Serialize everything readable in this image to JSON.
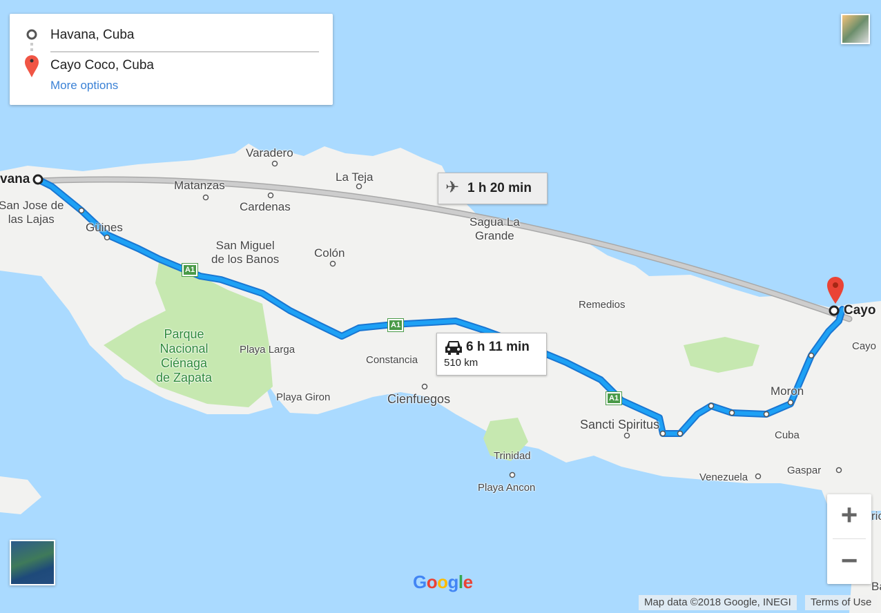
{
  "directions": {
    "origin": "Havana, Cuba",
    "destination": "Cayo Coco, Cuba",
    "more_options": "More options"
  },
  "routes": {
    "flight": {
      "icon": "airplane-icon",
      "duration": "1 h 20 min"
    },
    "driving": {
      "icon": "car-icon",
      "duration": "6 h 11 min",
      "distance": "510 km"
    }
  },
  "map": {
    "labels": [
      "vana",
      "San Jose de\nlas Lajas",
      "Güines",
      "Matanzas",
      "Varadero",
      "Cardenas",
      "La Teja",
      "San Miguel\nde los Banos",
      "Colón",
      "Sagua La\nGrande",
      "Remedios",
      "Cayo",
      "Cayo",
      "Parque\nNacional\nCiénaga\nde Zapata",
      "Playa Larga",
      "Constancia",
      "Playa Giron",
      "Cienfuegos",
      "Trinidad",
      "Playa Ancon",
      "Sancti Spiritus",
      "Moron",
      "Cuba",
      "Gaspar",
      "Venezuela",
      "ric",
      "Ba"
    ],
    "highway_shield": "A1",
    "colors": {
      "water": "#aadaff",
      "land": "#f2f2f0",
      "park": "#c6e8b0",
      "route": "#1a9af0",
      "route_outline": "#1976d2",
      "flight": "#bdbdbd",
      "marker": "#ea4335"
    }
  },
  "controls": {
    "zoom_in": "+",
    "zoom_out": "−"
  },
  "footer": {
    "logo": "Google",
    "attribution": "Map data ©2018 Google, INEGI",
    "terms": "Terms of Use"
  }
}
